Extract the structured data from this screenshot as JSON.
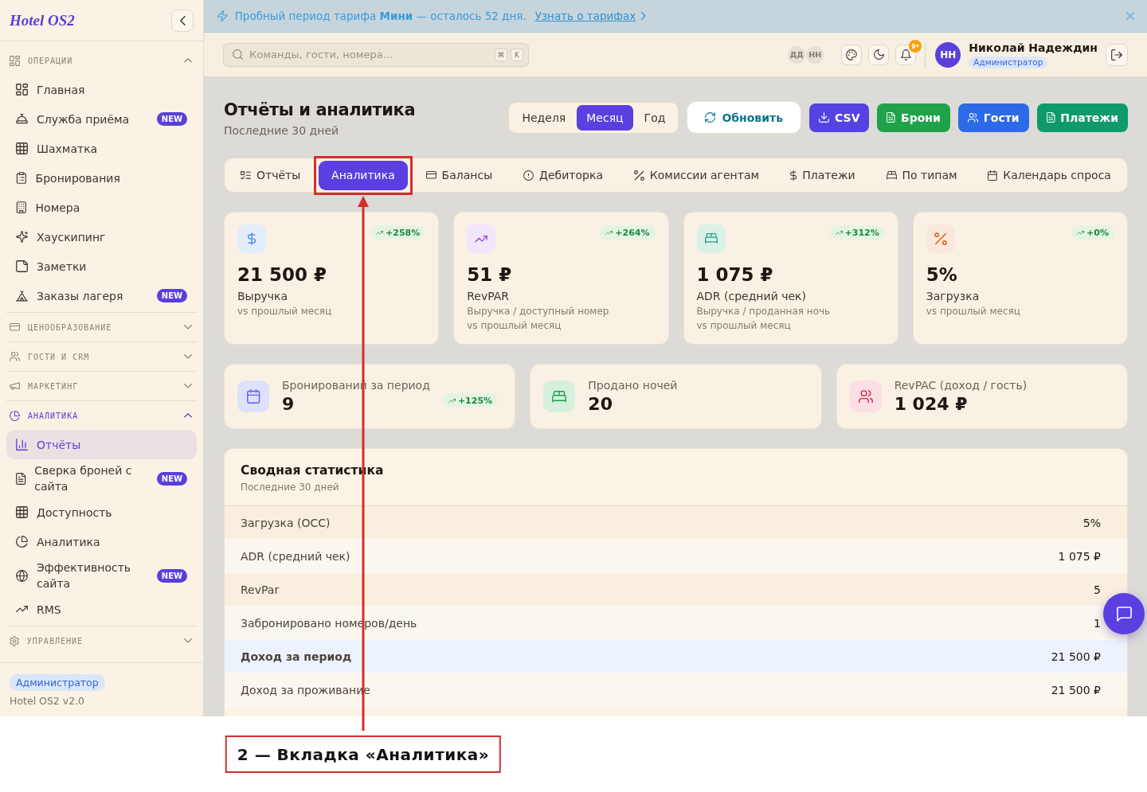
{
  "sidebar": {
    "logo": "Hotel OS2",
    "groups": [
      {
        "label": "ОПЕРАЦИИ",
        "expanded": true,
        "items": [
          {
            "label": "Главная",
            "selected": false
          },
          {
            "label": "Служба приёма",
            "badge": "NEW",
            "selected": false
          },
          {
            "label": "Шахматка",
            "selected": false
          },
          {
            "label": "Бронирования",
            "selected": false
          },
          {
            "label": "Номера",
            "selected": false
          },
          {
            "label": "Хаускипинг",
            "selected": false
          },
          {
            "label": "Заметки",
            "selected": false
          },
          {
            "label": "Заказы лагеря",
            "badge": "NEW",
            "selected": false
          }
        ]
      },
      {
        "label": "ЦЕНООБРАЗОВАНИЕ",
        "expanded": false
      },
      {
        "label": "ГОСТИ И CRM",
        "expanded": false
      },
      {
        "label": "МАРКЕТИНГ",
        "expanded": false
      },
      {
        "label": "АНАЛИТИКА",
        "expanded": true,
        "items": [
          {
            "label": "Отчёты",
            "selected": true
          },
          {
            "label": "Сверка броней с сайта",
            "badge": "NEW",
            "selected": false
          },
          {
            "label": "Доступность",
            "selected": false
          },
          {
            "label": "Аналитика",
            "selected": false
          },
          {
            "label": "Эффективность сайта",
            "badge": "NEW",
            "selected": false
          },
          {
            "label": "RMS",
            "selected": false
          }
        ]
      },
      {
        "label": "УПРАВЛЕНИЕ",
        "expanded": false
      }
    ],
    "role": "Администратор",
    "version": "Hotel OS2 v2.0"
  },
  "banner": {
    "text": "Пробный период тарифа **Мини** — осталось 52 дня.",
    "link": "Узнать о тарифах"
  },
  "topbar": {
    "search": {
      "placeholder": "Команды, гости, номера...",
      "keys": [
        "⌘",
        "K"
      ]
    },
    "presence": [
      "ДД",
      "НН"
    ],
    "notifications": "9+",
    "user": {
      "initials": "НН",
      "name": "Николай Надеждин",
      "role": "Администратор"
    }
  },
  "header": {
    "title": "Отчёты и аналитика",
    "subtitle": "Последние 30 дней",
    "periods": [
      {
        "label": "Неделя",
        "selected": false
      },
      {
        "label": "Месяц",
        "selected": true
      },
      {
        "label": "Год",
        "selected": false
      }
    ],
    "refresh": "Обновить",
    "exports": [
      "CSV",
      "Брони",
      "Гости",
      "Платежи"
    ]
  },
  "tabs": [
    {
      "label": "Отчёты",
      "selected": false
    },
    {
      "label": "Аналитика",
      "selected": true
    },
    {
      "label": "Балансы",
      "selected": false
    },
    {
      "label": "Дебиторка",
      "selected": false
    },
    {
      "label": "Комиссии агентам",
      "selected": false
    },
    {
      "label": "Платежи",
      "selected": false
    },
    {
      "label": "По типам",
      "selected": false
    },
    {
      "label": "Календарь спроса",
      "selected": false
    }
  ],
  "kpis": [
    {
      "value": "21 500 ₽",
      "label": "Выручка",
      "notes": [
        "vs прошлый месяц"
      ],
      "trend": "+258%"
    },
    {
      "value": "51 ₽",
      "label": "RevPAR",
      "notes": [
        "Выручка / доступный номер",
        "vs прошлый месяц"
      ],
      "trend": "+264%"
    },
    {
      "value": "1 075 ₽",
      "label": "ADR (средний чек)",
      "notes": [
        "Выручка / проданная ночь",
        "vs прошлый месяц"
      ],
      "trend": "+312%"
    },
    {
      "value": "5%",
      "label": "Загрузка",
      "notes": [
        "vs прошлый месяц"
      ],
      "trend": "+0%"
    }
  ],
  "stats": [
    {
      "label": "Бронирований за период",
      "value": "9",
      "trend": "+125%"
    },
    {
      "label": "Продано ночей",
      "value": "20"
    },
    {
      "label": "RevPAC (доход / гость)",
      "value": "1 024 ₽"
    }
  ],
  "summary": {
    "title": "Сводная статистика",
    "subtitle": "Последние 30 дней",
    "rows": [
      {
        "label": "Загрузка (OCC)",
        "value": "5%",
        "emphasized": false
      },
      {
        "label": "ADR (средний чек)",
        "value": "1 075 ₽",
        "emphasized": false
      },
      {
        "label": "RevPar",
        "value": "5",
        "emphasized": false
      },
      {
        "label": "Забронировано номеров/день",
        "value": "1",
        "emphasized": false
      },
      {
        "label": "Доход за период",
        "value": "21 500 ₽",
        "emphasized": true
      },
      {
        "label": "Доход за проживание",
        "value": "21 500 ₽",
        "emphasized": false
      }
    ]
  },
  "annotation": {
    "caption": "2 — Вкладка «Аналитика»"
  }
}
